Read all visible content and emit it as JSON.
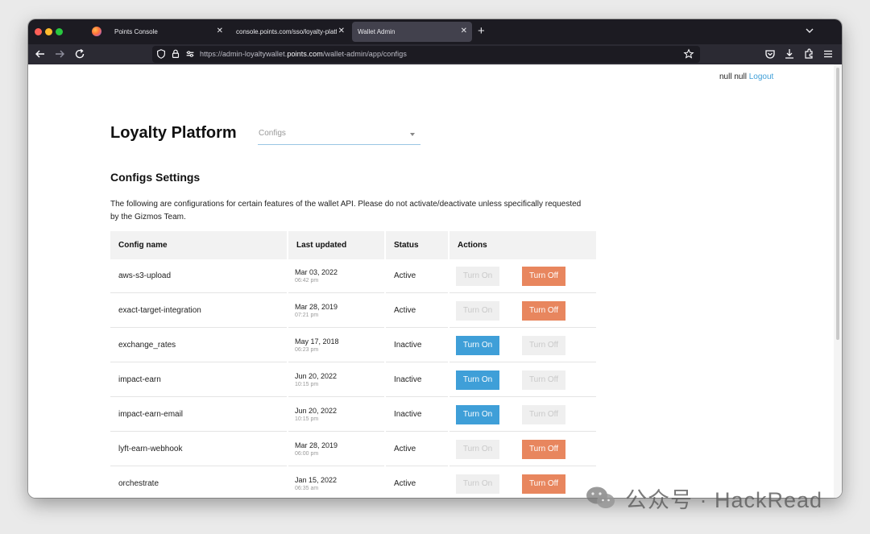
{
  "browser": {
    "tabs": [
      {
        "title": "Points Console",
        "active": false
      },
      {
        "title": "console.points.com/sso/loyalty-platform",
        "active": false
      },
      {
        "title": "Wallet Admin",
        "active": true
      }
    ],
    "url_prefix": "https://admin-loyaltywallet.",
    "url_domain": "points.com",
    "url_path": "/wallet-admin/app/configs"
  },
  "header": {
    "user_name": "null null",
    "logout_label": "Logout",
    "title": "Loyalty Platform",
    "select_value": "Configs"
  },
  "configs": {
    "title": "Configs Settings",
    "description": "The following are configurations for certain features of the wallet API. Please do not activate/deactivate unless specifically requested by the Gizmos Team.",
    "columns": [
      "Config name",
      "Last updated",
      "Status",
      "Actions"
    ],
    "turn_on_label": "Turn On",
    "turn_off_label": "Turn Off",
    "rows": [
      {
        "name": "aws-s3-upload",
        "date": "Mar 03, 2022",
        "time": "06:42 pm",
        "status": "Active"
      },
      {
        "name": "exact-target-integration",
        "date": "Mar 28, 2019",
        "time": "07:21 pm",
        "status": "Active"
      },
      {
        "name": "exchange_rates",
        "date": "May 17, 2018",
        "time": "06:23 pm",
        "status": "Inactive"
      },
      {
        "name": "impact-earn",
        "date": "Jun 20, 2022",
        "time": "10:15 pm",
        "status": "Inactive"
      },
      {
        "name": "impact-earn-email",
        "date": "Jun 20, 2022",
        "time": "10:15 pm",
        "status": "Inactive"
      },
      {
        "name": "lyft-earn-webhook",
        "date": "Mar 28, 2019",
        "time": "06:00 pm",
        "status": "Active"
      },
      {
        "name": "orchestrate",
        "date": "Jan 15, 2022",
        "time": "06:35 am",
        "status": "Active"
      }
    ]
  },
  "colors": {
    "accent_blue": "#3f9fd8",
    "turn_off_orange": "#e8865e",
    "disabled_gray": "#efefef"
  },
  "watermark": {
    "text": "公众号 · HackRead"
  }
}
